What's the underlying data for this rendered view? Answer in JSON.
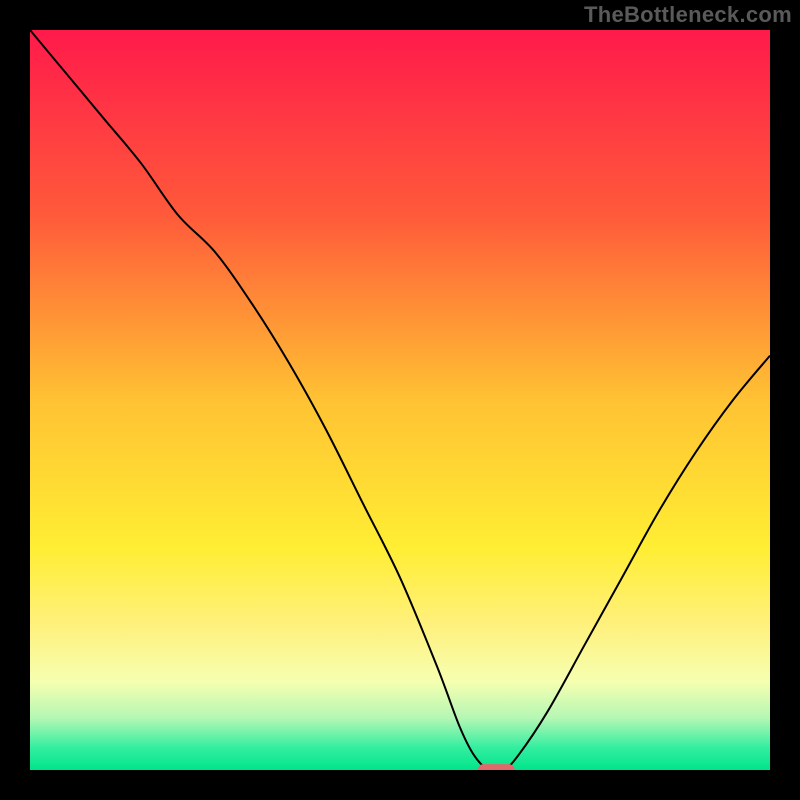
{
  "watermark": "TheBottleneck.com",
  "chart_data": {
    "type": "line",
    "title": "",
    "xlabel": "",
    "ylabel": "",
    "xlim": [
      0,
      100
    ],
    "ylim": [
      0,
      100
    ],
    "grid": false,
    "legend": false,
    "background_gradient": {
      "stops": [
        {
          "offset": 0.0,
          "color": "#ff1a4b"
        },
        {
          "offset": 0.25,
          "color": "#ff5a3a"
        },
        {
          "offset": 0.5,
          "color": "#ffc233"
        },
        {
          "offset": 0.7,
          "color": "#ffee33"
        },
        {
          "offset": 0.8,
          "color": "#fff07a"
        },
        {
          "offset": 0.88,
          "color": "#f6ffb0"
        },
        {
          "offset": 0.93,
          "color": "#b4f7b4"
        },
        {
          "offset": 0.97,
          "color": "#33eea0"
        },
        {
          "offset": 1.0,
          "color": "#00e58a"
        }
      ]
    },
    "series": [
      {
        "name": "bottleneck-curve",
        "color": "#000000",
        "width": 2,
        "x": [
          0,
          5,
          10,
          15,
          20,
          25,
          30,
          35,
          40,
          45,
          50,
          55,
          58,
          60,
          62,
          64,
          66,
          70,
          75,
          80,
          85,
          90,
          95,
          100
        ],
        "y": [
          100,
          94,
          88,
          82,
          75,
          70,
          63,
          55,
          46,
          36,
          26,
          14,
          6,
          2,
          0,
          0,
          2,
          8,
          17,
          26,
          35,
          43,
          50,
          56
        ]
      }
    ],
    "marker": {
      "name": "optimal-marker",
      "shape": "pill",
      "color": "#e06a6a",
      "x_center": 63,
      "y": 0,
      "width_x_units": 5,
      "height_y_units": 1.6
    }
  }
}
